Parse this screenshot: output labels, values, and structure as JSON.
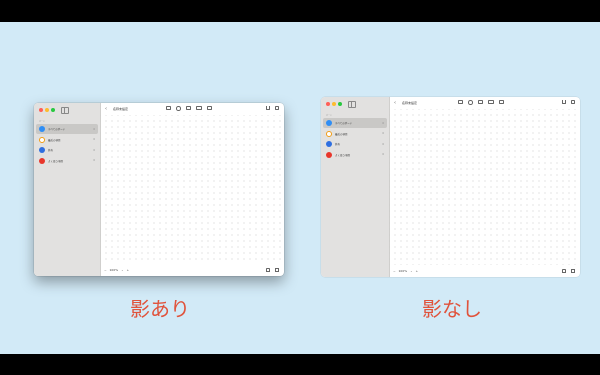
{
  "captions": {
    "with_shadow": "影あり",
    "without_shadow": "影なし"
  },
  "window": {
    "title": "名称未設定",
    "back_icon": "chevron-left-icon",
    "sidebar_section": "ボード",
    "sidebar_items": [
      {
        "label": "すべてのボード",
        "count": "0",
        "icon": "board-icon",
        "color": "#2f8ef5"
      },
      {
        "label": "最近の項目",
        "count": "0",
        "icon": "clock-icon",
        "color": "#f39c12"
      },
      {
        "label": "共有",
        "count": "0",
        "icon": "people-icon",
        "color": "#2f6fe0"
      },
      {
        "label": "よく使う項目",
        "count": "0",
        "icon": "heart-icon",
        "color": "#e8362b"
      }
    ],
    "toolbar_icons": [
      "sticky-note-icon",
      "shape-icon",
      "text-icon",
      "media-icon",
      "folder-icon"
    ],
    "right_icons": [
      "share-icon",
      "edit-icon"
    ],
    "zoom": {
      "minus": "−",
      "value": "100%",
      "chevron": "⌄",
      "plus": "+"
    },
    "bottom_icons": [
      "home-icon",
      "navigator-icon"
    ]
  },
  "colors": {
    "background": "#d2eaf7",
    "caption": "#e0533c",
    "sidebar": "#e2e1e0"
  }
}
